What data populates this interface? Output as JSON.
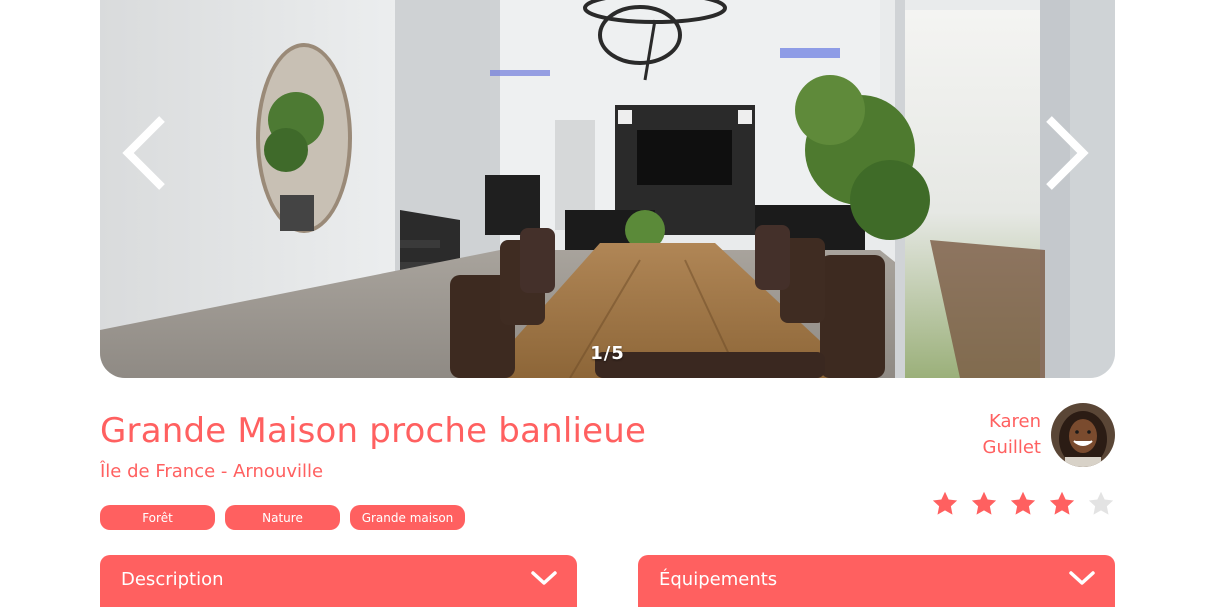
{
  "carousel": {
    "counter": "1/5",
    "prev_icon": "chevron-left-icon",
    "next_icon": "chevron-right-icon"
  },
  "listing": {
    "title": "Grande Maison proche banlieue",
    "location": "Île de France - Arnouville",
    "tags": [
      "Forêt",
      "Nature",
      "Grande maison"
    ]
  },
  "host": {
    "first_name": "Karen",
    "last_name": "Guillet"
  },
  "rating": {
    "value": 4,
    "max": 5
  },
  "collapses": [
    {
      "label": "Description",
      "icon": "chevron-down-icon"
    },
    {
      "label": "Équipements",
      "icon": "chevron-down-icon"
    }
  ],
  "colors": {
    "accent": "#FF6060",
    "star_empty": "#E3E3E3",
    "white": "#FFFFFF"
  }
}
